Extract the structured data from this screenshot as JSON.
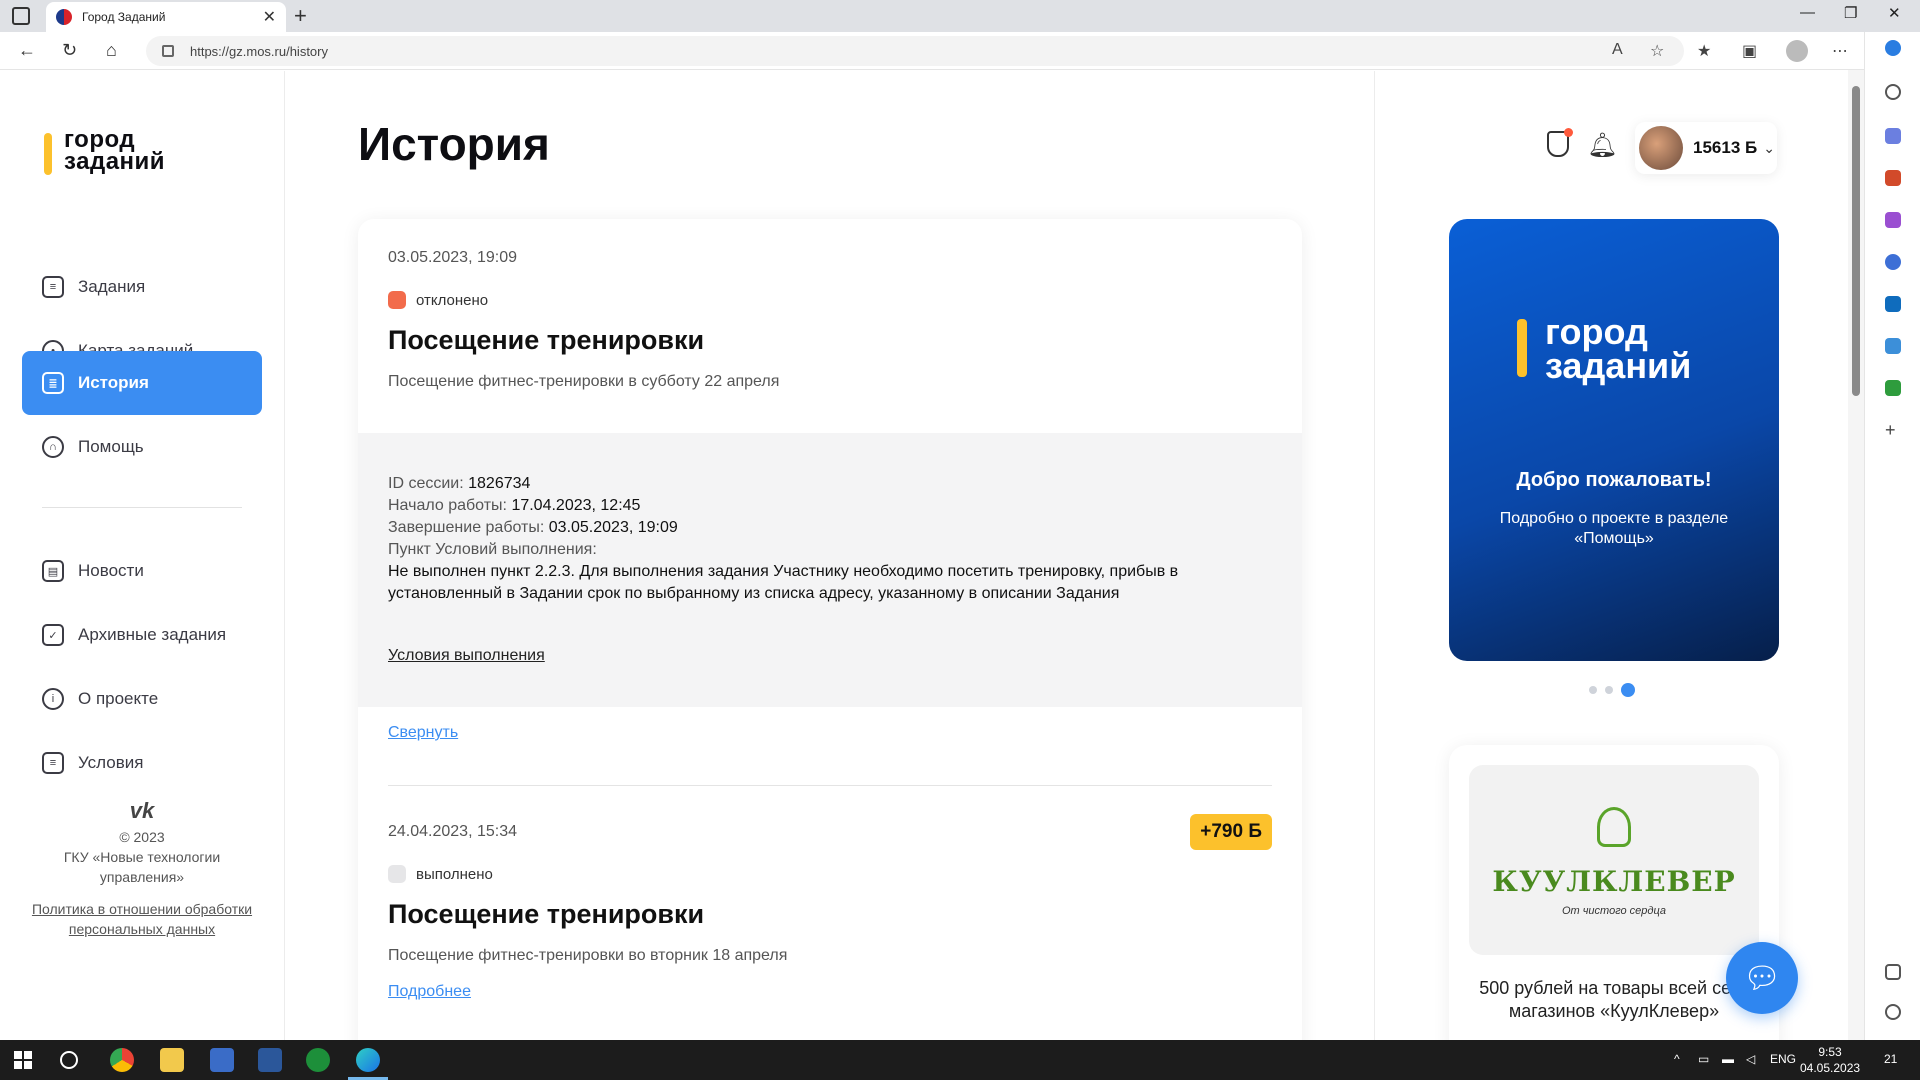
{
  "browser": {
    "tab_title": "Город Заданий",
    "url": "https://gz.mos.ru/history"
  },
  "sidebar": {
    "logo": [
      "город",
      "заданий"
    ],
    "items": [
      {
        "label": "Задания",
        "icon": "list-icon"
      },
      {
        "label": "Карта заданий",
        "icon": "map-pin-icon"
      },
      {
        "label": "История",
        "icon": "history-icon",
        "active": true
      },
      {
        "label": "Помощь",
        "icon": "headset-icon"
      },
      {
        "label": "Новости",
        "icon": "news-icon"
      },
      {
        "label": "Архивные задания",
        "icon": "archive-check-icon"
      },
      {
        "label": "О проекте",
        "icon": "info-icon"
      },
      {
        "label": "Условия",
        "icon": "document-icon"
      }
    ],
    "footer": {
      "social": "vk-icon",
      "copyright": "© 2023",
      "org": "ГКУ «Новые технологии управления»",
      "policy": "Политика в отношении обработки персональных данных"
    }
  },
  "main": {
    "title": "История",
    "entries": [
      {
        "date": "03.05.2023, 19:09",
        "status": "отклонено",
        "status_color": "#f26b4b",
        "title": "Посещение тренировки",
        "description": "Посещение фитнес-тренировки в субботу 22 апреля",
        "details": {
          "session_label": "ID сессии:",
          "session_value": "1826734",
          "start_label": "Начало работы:",
          "start_value": "17.04.2023, 12:45",
          "end_label": "Завершение работы:",
          "end_value": "03.05.2023, 19:09",
          "clause_label": "Пункт Условий выполнения:",
          "clause_value": "Не выполнен пункт 2.2.3. Для выполнения задания Участнику необходимо посетить тренировку, прибыв в установленный в Задании срок по выбранному из списка адресу, указанному в описании Задания",
          "terms_link": "Условия выполнения"
        },
        "collapse_link": "Свернуть"
      },
      {
        "date": "24.04.2023, 15:34",
        "points": "+790 Б",
        "status": "выполнено",
        "status_color": "#e6e6e8",
        "title": "Посещение тренировки",
        "description": "Посещение фитнес-тренировки во вторник 18 апреля",
        "more_link": "Подробнее"
      }
    ]
  },
  "header": {
    "balance": "15613 Б"
  },
  "promo": {
    "logo": [
      "город",
      "заданий"
    ],
    "title": "Добро пожаловать!",
    "subtitle": "Подробно о проекте в разделе «Помощь»",
    "slides": 3,
    "active_slide": 3
  },
  "offer": {
    "brand": "КУУЛКЛЕВЕР",
    "tagline": "От чистого сердца",
    "text": "500 рублей на товары всей сети магазинов «КуулКлевер»"
  },
  "taskbar": {
    "lang": "ENG",
    "time": "9:53",
    "date": "04.05.2023",
    "notifications": "21"
  },
  "colors": {
    "accent": "#3b8df2",
    "brand_yellow": "#fcc12c",
    "promo_blue": "#0a5fd6"
  }
}
